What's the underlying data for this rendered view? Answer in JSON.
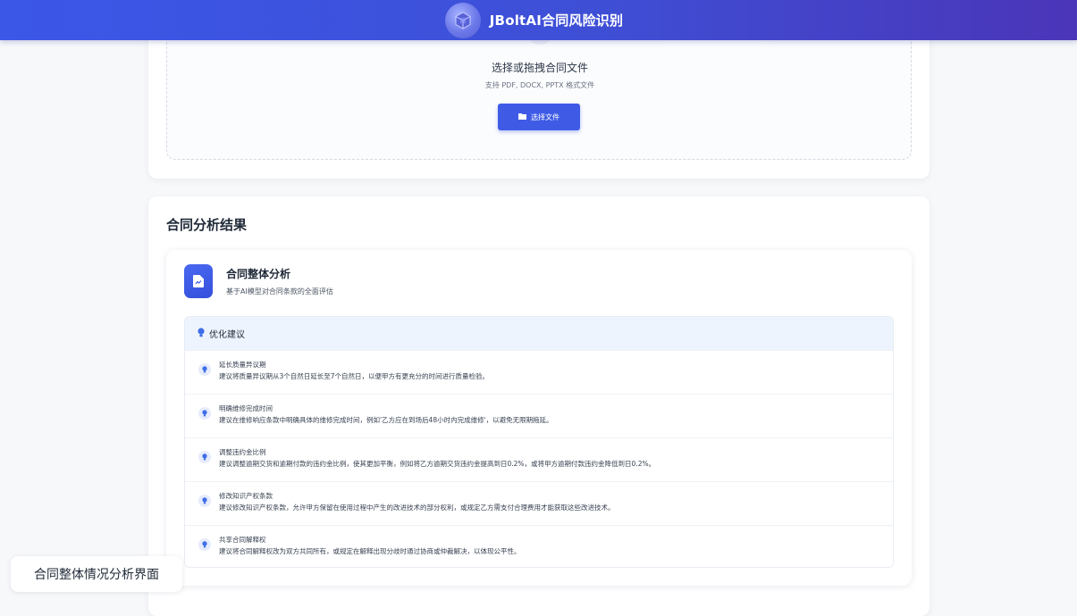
{
  "header": {
    "title": "JBoltAI合同风险识别",
    "logo_icon": "cube-logo-icon"
  },
  "upload": {
    "title": "选择或拖拽合同文件",
    "subtitle": "支持 PDF, DOCX, PPTX 格式文件",
    "button_label": "选择文件",
    "button_icon": "folder-icon"
  },
  "results": {
    "title": "合同分析结果",
    "overall": {
      "title": "合同整体分析",
      "subtitle": "基于AI模型对合同条款的全面评估",
      "icon": "document-icon"
    },
    "suggestions": {
      "header": "优化建议",
      "items": [
        {
          "title": "延长质量异议期",
          "desc": "建议将质量异议期从3个自然日延长至7个自然日，以便甲方有更充分的时间进行质量检验。"
        },
        {
          "title": "明确维修完成时间",
          "desc": "建议在维修响应条款中明确具体的维修完成时间，例如'乙方应在到场后48小时内完成维修'，以避免无限期拖延。"
        },
        {
          "title": "调整违约金比例",
          "desc": "建议调整逾期交货和逾期付款的违约金比例，使其更加平衡，例如将乙方逾期交货违约金提高到日0.2%，或将甲方逾期付款违约金降低到日0.2%。"
        },
        {
          "title": "修改知识产权条款",
          "desc": "建议修改知识产权条款，允许甲方保留在使用过程中产生的改进技术的部分权利，或规定乙方需支付合理费用才能获取这些改进技术。"
        },
        {
          "title": "共享合同解释权",
          "desc": "建议将合同解释权改为双方共同所有，或规定在解释出现分歧时通过协商或仲裁解决，以体现公平性。"
        }
      ]
    }
  },
  "caption": "合同整体情况分析界面",
  "colors": {
    "accent": "#3f5be6",
    "header_start": "#3b57e8",
    "header_end": "#4b35b8",
    "suggestion_bg": "#eef4fd"
  }
}
